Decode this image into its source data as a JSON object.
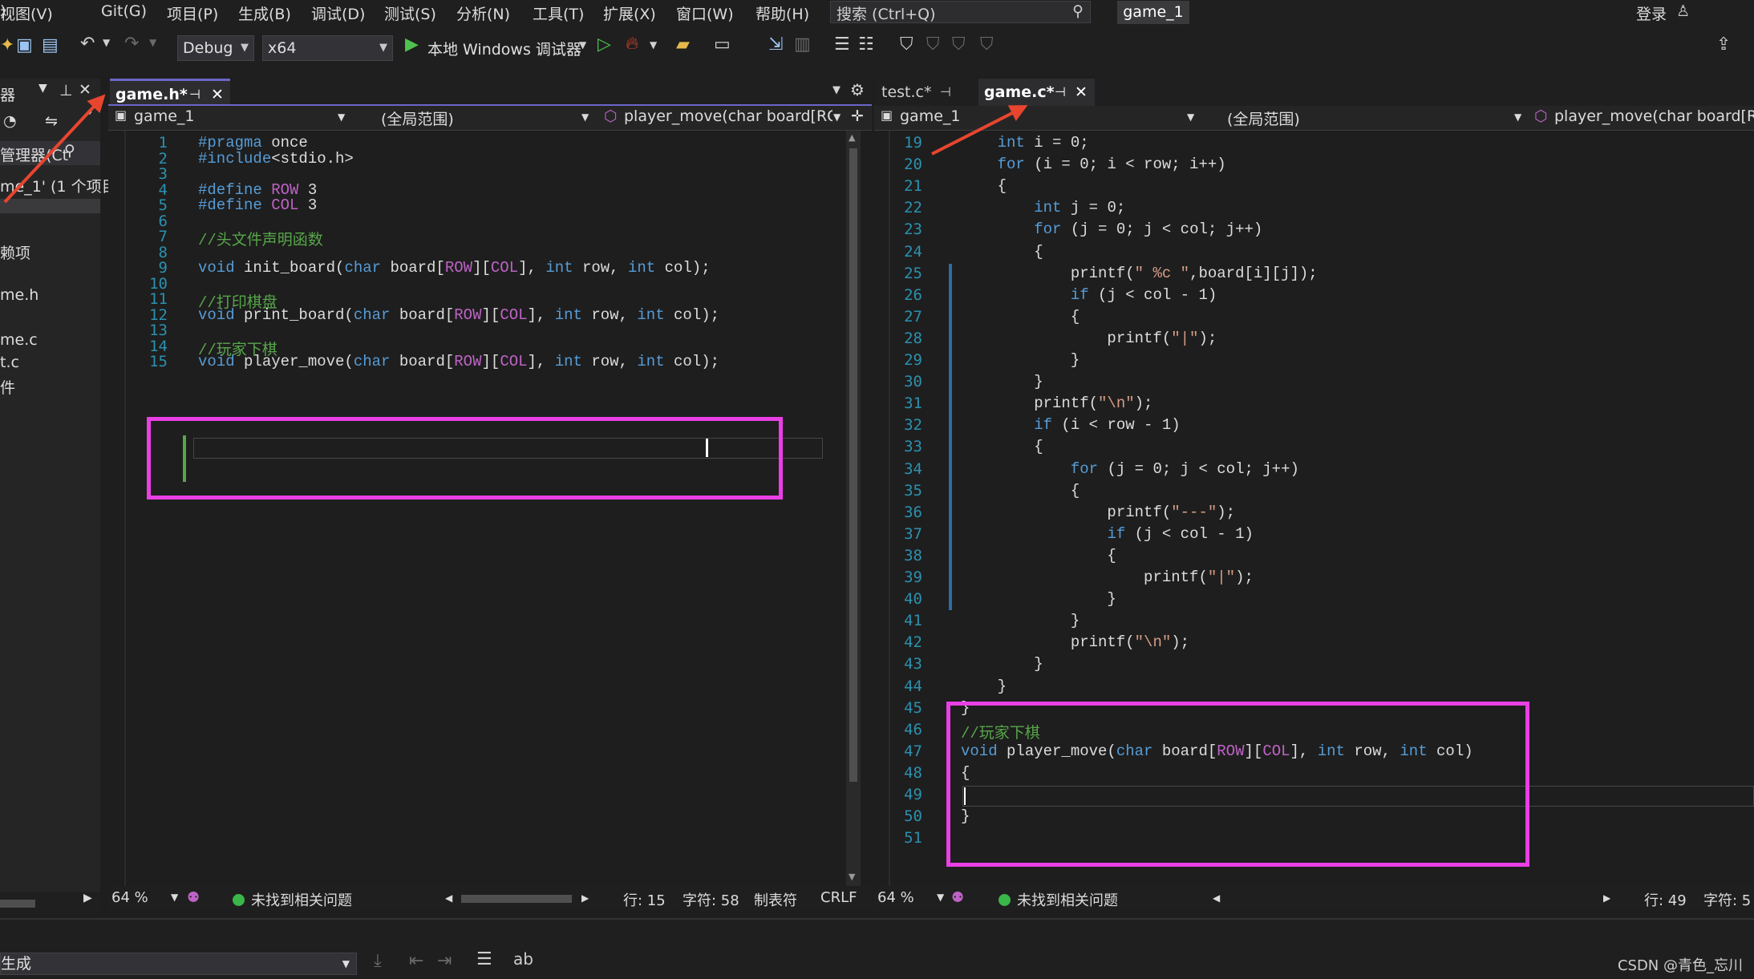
{
  "menu": {
    "items": [
      "视图(V)",
      "Git(G)",
      "项目(P)",
      "生成(B)",
      "调试(D)",
      "测试(S)",
      "分析(N)",
      "工具(T)",
      "扩展(X)",
      "窗口(W)",
      "帮助(H)"
    ],
    "search_placeholder": "搜索 (Ctrl+Q)",
    "solution_title": "game_1",
    "login": "登录"
  },
  "toolbar": {
    "config": "Debug",
    "platform": "x64",
    "run_label": "本地 Windows 调试器"
  },
  "left_panel": {
    "header": "器",
    "title": "管理器(Ct",
    "items": [
      "me_1' (1 个项目",
      "赖项",
      "me.h",
      "me.c",
      "t.c",
      "件"
    ]
  },
  "left_editor": {
    "tab_label": "game.h*",
    "project": "game_1",
    "scope": "(全局范围)",
    "member": "player_move(char board[ROW",
    "line_numbers": [
      "1",
      "2",
      "3",
      "4",
      "5",
      "6",
      "7",
      "8",
      "9",
      "10",
      "11",
      "12",
      "13",
      "14",
      "15"
    ],
    "code": [
      "#pragma once",
      "#include<stdio.h>",
      "",
      "#define ROW 3",
      "#define COL 3",
      "",
      "//头文件声明函数",
      "",
      "void init_board(char board[ROW][COL], int row, int col);",
      "",
      "//打印棋盘",
      "void print_board(char board[ROW][COL], int row, int col);",
      "",
      "//玩家下棋",
      "void player_move(char board[ROW][COL], int row, int col);"
    ],
    "status": {
      "zoom": "64 %",
      "issues": "未找到相关问题",
      "line": "行: 15",
      "char": "字符: 58",
      "tabs": "制表符",
      "eol": "CRLF"
    }
  },
  "right_editor": {
    "tabs": [
      "test.c*",
      "game.c*"
    ],
    "project": "game_1",
    "scope": "(全局范围)",
    "member": "player_move(char board[RO",
    "line_numbers": [
      "19",
      "20",
      "21",
      "22",
      "23",
      "24",
      "25",
      "26",
      "27",
      "28",
      "29",
      "30",
      "31",
      "32",
      "33",
      "34",
      "35",
      "36",
      "37",
      "38",
      "39",
      "40",
      "41",
      "42",
      "43",
      "44",
      "45",
      "46",
      "47",
      "48",
      "49",
      "50",
      "51"
    ],
    "code": [
      "    int i = 0;",
      "    for (i = 0; i < row; i++)",
      "    {",
      "        int j = 0;",
      "        for (j = 0; j < col; j++)",
      "        {",
      "            printf(\" %c \",board[i][j]);",
      "            if (j < col - 1)",
      "            {",
      "                printf(\"|\");",
      "            }",
      "        }",
      "        printf(\"\\n\");",
      "        if (i < row - 1)",
      "        {",
      "            for (j = 0; j < col; j++)",
      "            {",
      "                printf(\"---\");",
      "                if (j < col - 1)",
      "                {",
      "                    printf(\"|\");",
      "                }",
      "            }",
      "            printf(\"\\n\");",
      "        }",
      "    }",
      "}",
      "//玩家下棋",
      "void player_move(char board[ROW][COL], int row, int col)",
      "{",
      "",
      "}",
      ""
    ],
    "status": {
      "zoom": "64 %",
      "issues": "未找到相关问题",
      "line": "行: 49",
      "char": "字符: 5"
    }
  },
  "bottom": {
    "output_source": "生成",
    "watermark": "CSDN @青色_忘川"
  },
  "colors": {
    "highlight": "#e93fe5",
    "arrow": "#e8452f",
    "accent": "#6b66c7"
  }
}
